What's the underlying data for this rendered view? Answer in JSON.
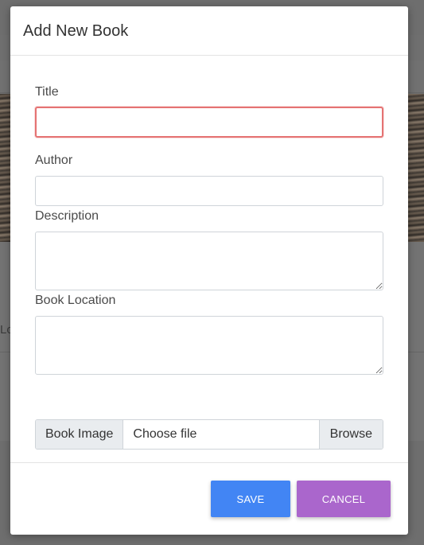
{
  "background": {
    "partial_text": "Lo"
  },
  "modal": {
    "title": "Add New Book",
    "fields": {
      "title_label": "Title",
      "title_value": "",
      "author_label": "Author",
      "author_value": "",
      "description_label": "Description",
      "description_value": "",
      "location_label": "Book Location",
      "location_value": ""
    },
    "file": {
      "prepend_label": "Book Image",
      "placeholder": "Choose file",
      "browse_label": "Browse"
    },
    "buttons": {
      "save_label": "SAVE",
      "cancel_label": "CANCEL"
    },
    "colors": {
      "save": "#4285f4",
      "cancel": "#aa66cc",
      "focus_border": "#e57373"
    }
  }
}
